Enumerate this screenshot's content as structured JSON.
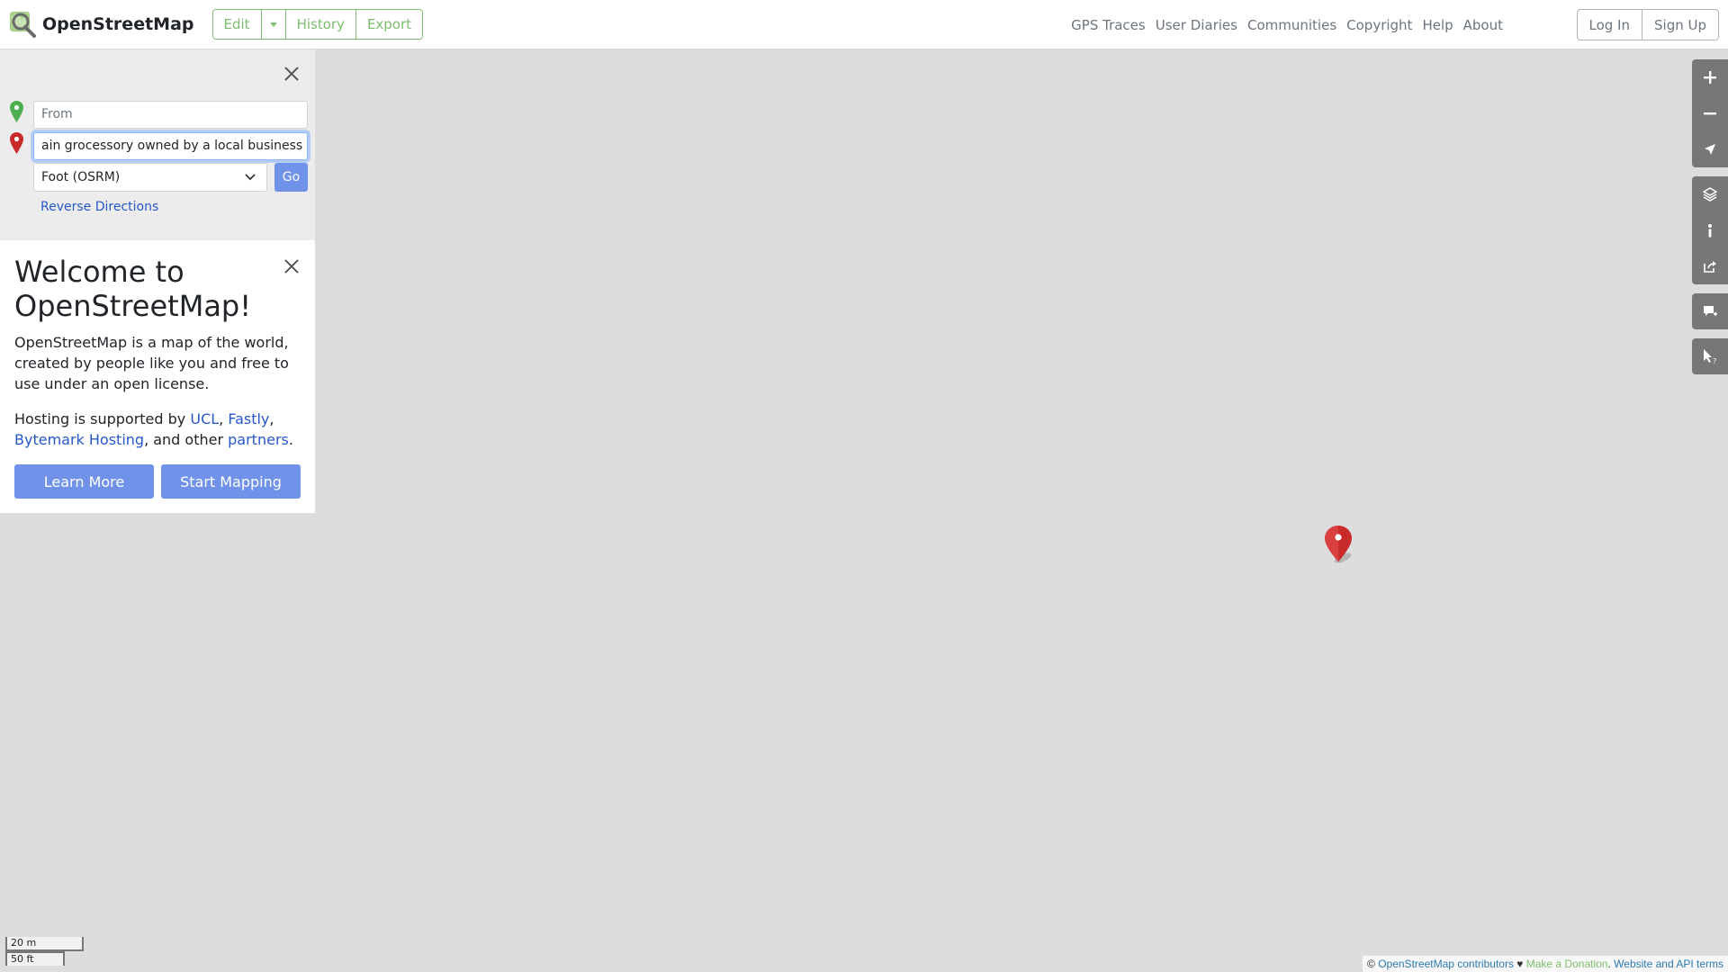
{
  "header": {
    "brand": "OpenStreetMap",
    "edit_group": {
      "edit": "Edit",
      "history": "History",
      "export": "Export"
    },
    "nav": [
      "GPS Traces",
      "User Diaries",
      "Communities",
      "Copyright",
      "Help",
      "About"
    ],
    "auth": {
      "login": "Log In",
      "signup": "Sign Up"
    }
  },
  "directions": {
    "from_placeholder": "From",
    "to_value": "Local mountain grocessory owned by a local business",
    "to_visible": "ain grocessory owned by a local business",
    "engine": "Foot (OSRM)",
    "go": "Go",
    "reverse": "Reverse Directions"
  },
  "welcome": {
    "title": "Welcome to OpenStreetMap!",
    "intro": "OpenStreetMap is a map of the world, created by people like you and free to use under an open license.",
    "hosting_prefix": "Hosting is supported by ",
    "ucl": "UCL",
    "sep1": ", ",
    "fastly": "Fastly",
    "sep2": ",",
    "bytemark": "Bytemark Hosting",
    "sep3": ", and other ",
    "partners": "partners",
    "period": ".",
    "learn_more": "Learn More",
    "start_mapping": "Start Mapping"
  },
  "map": {
    "scale_metric": "20 m",
    "scale_imperial": "50 ft",
    "attribution": {
      "copy": "© ",
      "contributors": "OpenStreetMap contributors",
      "heart": " ♥ ",
      "donate": "Make a Donation",
      "dot": ". ",
      "terms": "Website and API terms"
    },
    "controls": [
      "zoom-in-icon",
      "zoom-out-icon",
      "locate-icon",
      "layers-icon",
      "info-icon",
      "share-icon",
      "add-note-icon",
      "query-feature-icon"
    ]
  },
  "colors": {
    "accent_green": "#7ebc6f",
    "button_blue": "#7092e8",
    "link_blue": "#2757c9",
    "marker_red": "#c92a2a",
    "marker_green": "#4caf50"
  }
}
